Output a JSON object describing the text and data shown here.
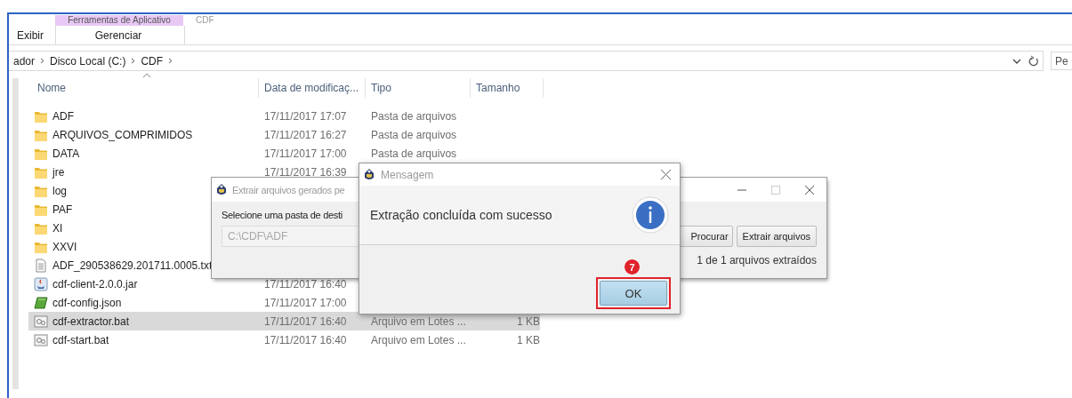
{
  "ribbon": {
    "context_tab": "Ferramentas de Aplicativo",
    "window_title": "CDF",
    "tabs": [
      {
        "label": "Exibir",
        "selected": false
      },
      {
        "label": "Gerenciar",
        "selected": true
      }
    ]
  },
  "address_bar": {
    "crumbs": [
      "ador",
      "Disco Local (C:)",
      "CDF"
    ]
  },
  "search": {
    "placeholder": "Pe"
  },
  "file_list": {
    "columns": [
      "Nome",
      "Data de modificaç...",
      "Tipo",
      "Tamanho"
    ],
    "rows": [
      {
        "kind": "folder",
        "name": "ADF",
        "date": "17/11/2017 17:07",
        "type": "Pasta de arquivos",
        "selected": false
      },
      {
        "kind": "folder",
        "name": "ARQUIVOS_COMPRIMIDOS",
        "date": "17/11/2017 16:27",
        "type": "Pasta de arquivos",
        "selected": false
      },
      {
        "kind": "folder",
        "name": "DATA",
        "date": "17/11/2017 17:00",
        "type": "Pasta de arquivos",
        "selected": false
      },
      {
        "kind": "folder",
        "name": "jre",
        "date": "17/11/2017 16:39",
        "selected": false
      },
      {
        "kind": "folder",
        "name": "log",
        "selected": false
      },
      {
        "kind": "folder",
        "name": "PAF",
        "selected": false
      },
      {
        "kind": "folder",
        "name": "XI",
        "selected": false
      },
      {
        "kind": "folder",
        "name": "XXVI",
        "selected": false
      },
      {
        "kind": "text",
        "name": "ADF_290538629.201711.0005.txt",
        "selected": false
      },
      {
        "kind": "jar",
        "name": "cdf-client-2.0.0.jar",
        "date": "17/11/2017 16:40",
        "selected": false
      },
      {
        "kind": "json",
        "name": "cdf-config.json",
        "date": "17/11/2017 17:00",
        "selected": false
      },
      {
        "kind": "batch",
        "name": "cdf-extractor.bat",
        "date": "17/11/2017 16:40",
        "type": "Arquivo em Lotes ...",
        "size": "1 KB",
        "selected": true
      },
      {
        "kind": "batch",
        "name": "cdf-start.bat",
        "date": "17/11/2017 16:40",
        "type": "Arquivo em Lotes ...",
        "size": "1 KB",
        "selected": false
      }
    ]
  },
  "extract_dialog": {
    "title": "Extrair arquivos gerados pe",
    "label": "Selecione uma pasta de desti",
    "folder_field": {
      "value": "C:\\CDF\\ADF",
      "disabled": true
    },
    "buttons": [
      "Procurar",
      "Extrair arquivos"
    ],
    "status": "1 de 1 arquivos extraídos"
  },
  "message_dialog": {
    "title": "Mensagem",
    "message": "Extração concluída com sucesso",
    "button": "OK",
    "annotation": {
      "step": "7"
    }
  }
}
